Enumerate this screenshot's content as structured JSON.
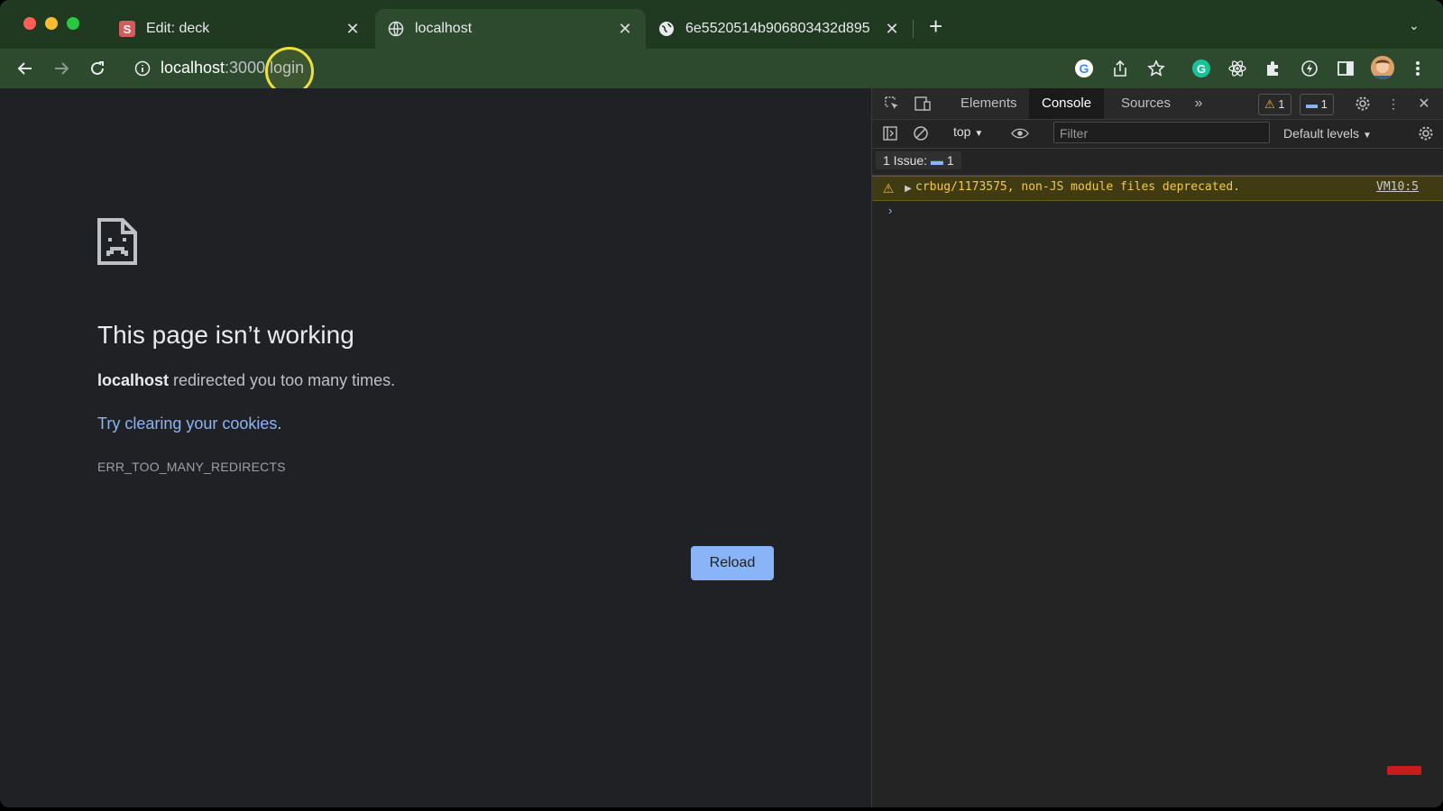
{
  "browser": {
    "tabs": [
      {
        "title": "Edit: deck",
        "favicon": "slides-s-icon",
        "favicon_letter": "S"
      },
      {
        "title": "localhost",
        "favicon": "globe-icon"
      },
      {
        "title": "6e5520514b906803432d895",
        "favicon": "globe-icon"
      }
    ],
    "active_tab": 1,
    "address": {
      "host": "localhost",
      "path": ":3000/login"
    }
  },
  "error_page": {
    "title": "This page isn’t working",
    "message_bold": "localhost",
    "message_rest": " redirected you too many times.",
    "hint_link": "Try clearing your cookies",
    "hint_end": ".",
    "code": "ERR_TOO_MANY_REDIRECTS",
    "reload_label": "Reload"
  },
  "devtools": {
    "tabs": [
      "Elements",
      "Console",
      "Sources"
    ],
    "active_tab": "Console",
    "warnings_count": "1",
    "messages_count": "1",
    "context": "top",
    "filter_placeholder": "Filter",
    "levels_label": "Default levels",
    "issues_label": "1 Issue:",
    "issues_count": "1",
    "console_warning": "crbug/1173575, non-JS module files deprecated.",
    "console_warning_source": "VM10:5",
    "prompt": "›"
  },
  "colors": {
    "tabstrip": "#1f3a20",
    "toolbar": "#2d4a2e",
    "page_bg": "#202124",
    "link": "#8ab4f8",
    "reload_button": "#8ab4f8",
    "warning_bg": "#413b14",
    "warning_text": "#f2c94c"
  }
}
